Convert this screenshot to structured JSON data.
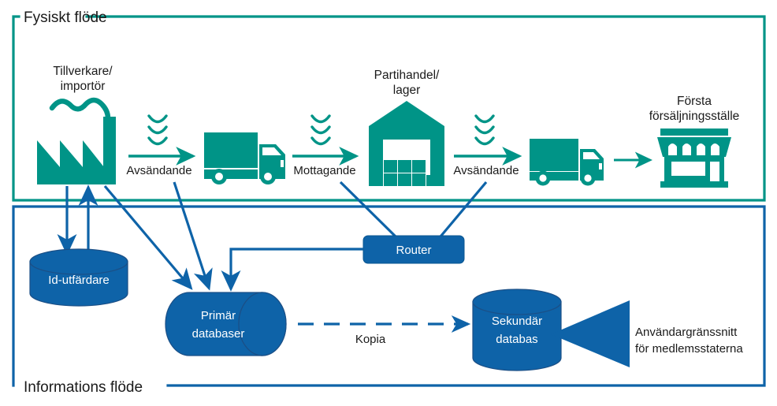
{
  "colors": {
    "teal": "#009487",
    "blue": "#0e63a8",
    "blue_dark": "#0a5590",
    "blue_edge": "#1b4f86",
    "text": "#1a1a1a",
    "white": "#ffffff",
    "background": "#ffffff"
  },
  "panels": {
    "physical": {
      "title": "Fysiskt flöde",
      "border_color": "#009487"
    },
    "information": {
      "title": "Informations flöde",
      "border_color": "#0e63a8"
    }
  },
  "physical_flow": {
    "nodes": [
      {
        "id": "manufacturer",
        "icon": "factory-icon",
        "label_lines": [
          "Tillverkare/",
          "importör"
        ]
      },
      {
        "id": "truck-1",
        "icon": "truck-icon",
        "label_lines": []
      },
      {
        "id": "wholesaler",
        "icon": "warehouse-icon",
        "label_lines": [
          "Partihandel/",
          "lager"
        ]
      },
      {
        "id": "truck-2",
        "icon": "truck-icon",
        "label_lines": []
      },
      {
        "id": "retailer",
        "icon": "shop-icon",
        "label_lines": [
          "Första",
          "försäljningsställe"
        ]
      }
    ],
    "arrows": [
      {
        "id": "arrow-1",
        "label": "Avsändande",
        "signal": true
      },
      {
        "id": "arrow-2",
        "label": "Mottagande",
        "signal": true
      },
      {
        "id": "arrow-3",
        "label": "Avsändande",
        "signal": true
      },
      {
        "id": "arrow-4",
        "label": "",
        "signal": false
      }
    ]
  },
  "information_flow": {
    "nodes": [
      {
        "id": "id-issuer",
        "shape": "cylinder-vertical",
        "label_lines": [
          "Id-utfärdare"
        ]
      },
      {
        "id": "router",
        "shape": "rounded-rect",
        "label_lines": [
          "Router"
        ]
      },
      {
        "id": "primary-database",
        "shape": "cylinder-horizontal",
        "label_lines": [
          "Primär",
          "databaser"
        ]
      },
      {
        "id": "secondary-database",
        "shape": "cylinder-vertical",
        "label_lines": [
          "Sekundär",
          "databas"
        ]
      }
    ],
    "edges": [
      {
        "id": "copy-edge",
        "label": "Kopia",
        "style": "dashed"
      }
    ],
    "annotations": [
      {
        "id": "member-state-ui",
        "lines": [
          "Användargränssnitt",
          "för medlemsstaterna"
        ]
      }
    ]
  }
}
